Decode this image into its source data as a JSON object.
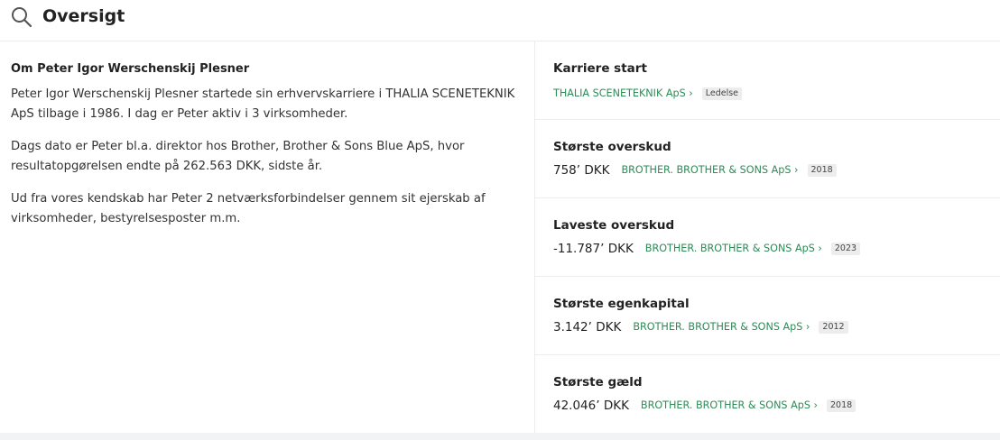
{
  "header": {
    "title": "Oversigt",
    "icon": "search-icon"
  },
  "about": {
    "heading": "Om Peter Igor Werschenskij Plesner",
    "paragraphs": [
      "Peter Igor Werschenskij Plesner startede sin erhvervskarriere i THALIA SCENETEKNIK ApS tilbage i 1986. I dag er Peter aktiv i 3 virksomheder.",
      "Dags dato er Peter bl.a. direktor hos Brother, Brother & Sons Blue ApS, hvor resultatopgørelsen endte på 262.563 DKK, sidste år.",
      "Ud fra vores kendskab har Peter 2 netværksforbindelser gennem sit ejerskab af virksomheder, bestyrelsesposter m.m."
    ]
  },
  "cards": [
    {
      "label": "Karriere start",
      "value": "",
      "link": "THALIA SCENETEKNIK ApS ›",
      "badge": "Ledelse"
    },
    {
      "label": "Største overskud",
      "value": "758’ DKK",
      "link": "BROTHER. BROTHER & SONS ApS ›",
      "badge": "2018"
    },
    {
      "label": "Laveste overskud",
      "value": "-11.787’ DKK",
      "link": "BROTHER. BROTHER & SONS ApS ›",
      "badge": "2023"
    },
    {
      "label": "Største egenkapital",
      "value": "3.142’ DKK",
      "link": "BROTHER. BROTHER & SONS ApS ›",
      "badge": "2012"
    },
    {
      "label": "Største gæld",
      "value": "42.046’ DKK",
      "link": "BROTHER. BROTHER & SONS ApS ›",
      "badge": "2018"
    }
  ],
  "colors": {
    "link": "#2e8b57",
    "divider": "#ececec",
    "badge_bg": "#ededed"
  }
}
